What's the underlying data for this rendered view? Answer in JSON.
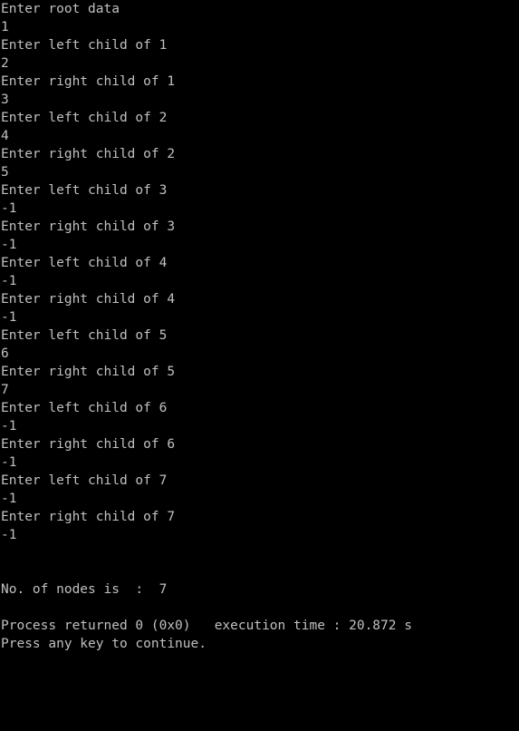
{
  "console": {
    "lines": [
      "Enter root data",
      "1",
      "Enter left child of 1",
      "2",
      "Enter right child of 1",
      "3",
      "Enter left child of 2",
      "4",
      "Enter right child of 2",
      "5",
      "Enter left child of 3",
      "-1",
      "Enter right child of 3",
      "-1",
      "Enter left child of 4",
      "-1",
      "Enter right child of 4",
      "-1",
      "Enter left child of 5",
      "6",
      "Enter right child of 5",
      "7",
      "Enter left child of 6",
      "-1",
      "Enter right child of 6",
      "-1",
      "Enter left child of 7",
      "-1",
      "Enter right child of 7",
      "-1",
      "",
      "",
      "No. of nodes is  :  7",
      "",
      "Process returned 0 (0x0)   execution time : 20.872 s",
      "Press any key to continue."
    ]
  },
  "colors": {
    "background": "#000000",
    "text": "#c0c0c0"
  }
}
